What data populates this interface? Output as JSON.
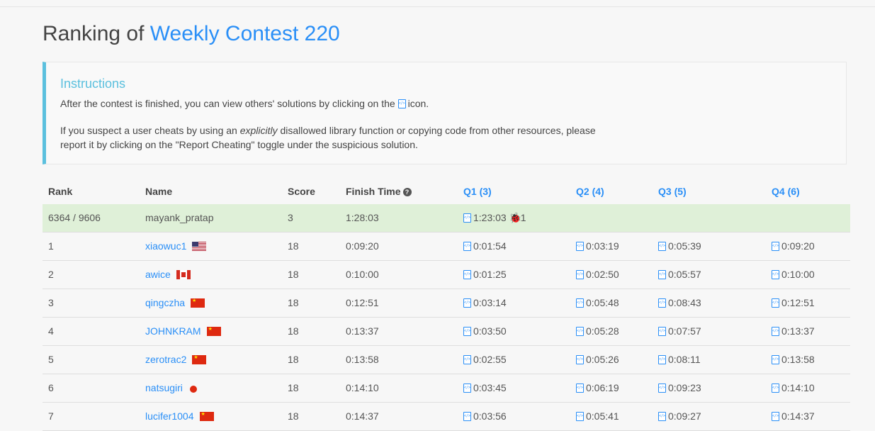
{
  "page": {
    "title_prefix": "Ranking of",
    "contest_name": "Weekly Contest 220"
  },
  "instructions": {
    "title": "Instructions",
    "p1_before": "After the contest is finished, you can view others' solutions by clicking on the",
    "p1_after": "icon.",
    "p2_part1": "If you suspect a user cheats by using an",
    "p2_em": "explicitly",
    "p2_part2": "disallowed library function or copying code from other resources, please report it by clicking on the \"Report Cheating\" toggle under the suspicious solution."
  },
  "table": {
    "headers": {
      "rank": "Rank",
      "name": "Name",
      "score": "Score",
      "finish_time": "Finish Time",
      "q1": "Q1 (3)",
      "q2": "Q2 (4)",
      "q3": "Q3 (5)",
      "q4": "Q4 (6)"
    },
    "me": {
      "rank": "6364 / 9606",
      "name": "mayank_pratap",
      "score": "3",
      "finish_time": "1:28:03",
      "q1_time": "1:23:03",
      "q1_bugs": "1"
    },
    "rows": [
      {
        "rank": "1",
        "name": "xiaowuc1",
        "flag": "US",
        "score": "18",
        "finish_time": "0:09:20",
        "q1": "0:01:54",
        "q2": "0:03:19",
        "q3": "0:05:39",
        "q4": "0:09:20"
      },
      {
        "rank": "2",
        "name": "awice",
        "flag": "CA",
        "score": "18",
        "finish_time": "0:10:00",
        "q1": "0:01:25",
        "q2": "0:02:50",
        "q3": "0:05:57",
        "q4": "0:10:00"
      },
      {
        "rank": "3",
        "name": "qingczha",
        "flag": "CN",
        "score": "18",
        "finish_time": "0:12:51",
        "q1": "0:03:14",
        "q2": "0:05:48",
        "q3": "0:08:43",
        "q4": "0:12:51"
      },
      {
        "rank": "4",
        "name": "JOHNKRAM",
        "flag": "CN",
        "score": "18",
        "finish_time": "0:13:37",
        "q1": "0:03:50",
        "q2": "0:05:28",
        "q3": "0:07:57",
        "q4": "0:13:37"
      },
      {
        "rank": "5",
        "name": "zerotrac2",
        "flag": "CN",
        "score": "18",
        "finish_time": "0:13:58",
        "q1": "0:02:55",
        "q2": "0:05:26",
        "q3": "0:08:11",
        "q4": "0:13:58"
      },
      {
        "rank": "6",
        "name": "natsugiri",
        "flag": "JP",
        "score": "18",
        "finish_time": "0:14:10",
        "q1": "0:03:45",
        "q2": "0:06:19",
        "q3": "0:09:23",
        "q4": "0:14:10"
      },
      {
        "rank": "7",
        "name": "lucifer1004",
        "flag": "CN",
        "score": "18",
        "finish_time": "0:14:37",
        "q1": "0:03:56",
        "q2": "0:05:41",
        "q3": "0:09:27",
        "q4": "0:14:37"
      }
    ]
  },
  "icons": {
    "code": "code-file-icon",
    "help": "question-circle-icon",
    "bug": "bug-icon"
  },
  "colors": {
    "accent": "#2a8ff7",
    "info": "#5bc0de",
    "highlight_row": "#dff0d8",
    "bug": "#c9302c"
  }
}
